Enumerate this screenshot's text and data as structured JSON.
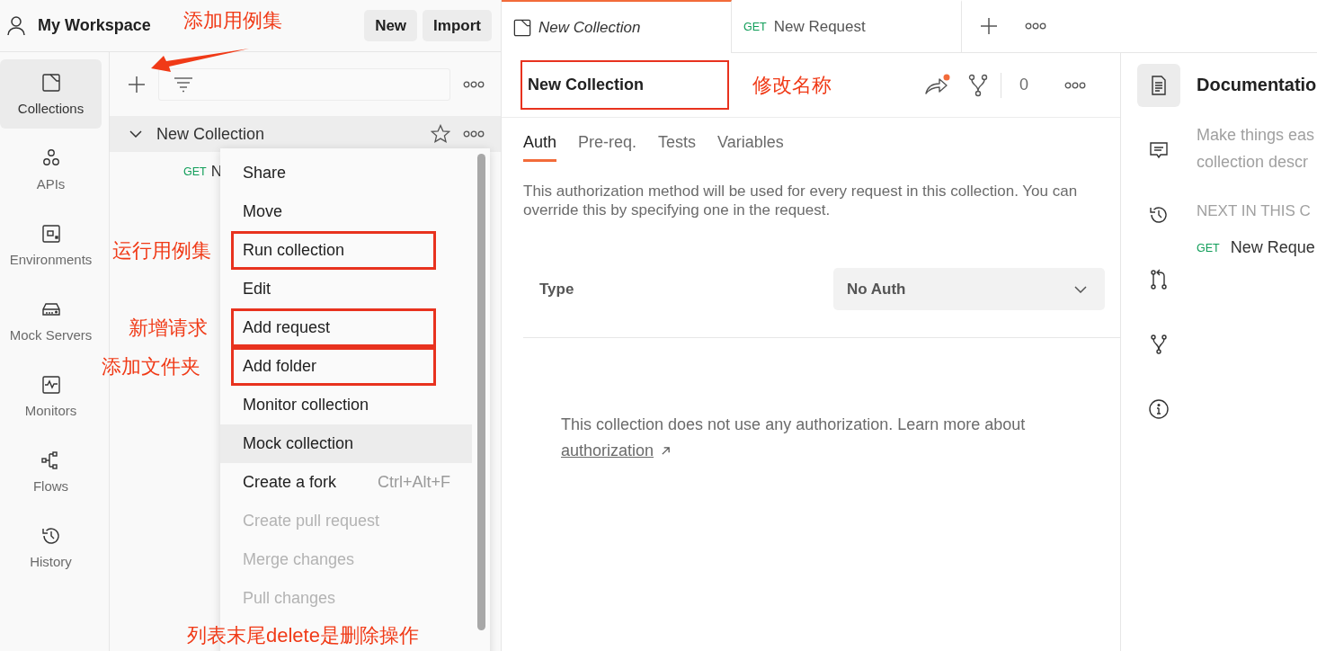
{
  "header": {
    "workspace": "My Workspace",
    "buttons": [
      "New",
      "Import"
    ]
  },
  "nav": [
    {
      "label": "Collections",
      "selected": true
    },
    {
      "label": "APIs",
      "selected": false
    },
    {
      "label": "Environments",
      "selected": false
    },
    {
      "label": "Mock Servers",
      "selected": false
    },
    {
      "label": "Monitors",
      "selected": false
    },
    {
      "label": "Flows",
      "selected": false
    },
    {
      "label": "History",
      "selected": false
    }
  ],
  "sidebar": {
    "collections": [
      {
        "name": "New Collection",
        "expanded": true,
        "starred": false,
        "children": [
          {
            "method": "GET",
            "name": "N"
          }
        ]
      }
    ]
  },
  "context_menu": {
    "items": [
      {
        "label": "Share",
        "disabled": false,
        "highlighted": false,
        "annotated": false
      },
      {
        "label": "Move",
        "disabled": false,
        "highlighted": false,
        "annotated": false
      },
      {
        "label": "Run collection",
        "disabled": false,
        "highlighted": false,
        "annotated": true
      },
      {
        "label": "Edit",
        "disabled": false,
        "highlighted": false,
        "annotated": false
      },
      {
        "label": "Add request",
        "disabled": false,
        "highlighted": false,
        "annotated": true
      },
      {
        "label": "Add folder",
        "disabled": false,
        "highlighted": false,
        "annotated": true
      },
      {
        "label": "Monitor collection",
        "disabled": false,
        "highlighted": false,
        "annotated": false
      },
      {
        "label": "Mock collection",
        "disabled": false,
        "highlighted": true,
        "annotated": false
      },
      {
        "label": "Create a fork",
        "shortcut": "Ctrl+Alt+F",
        "disabled": false,
        "highlighted": false,
        "annotated": false
      },
      {
        "label": "Create pull request",
        "disabled": true,
        "highlighted": false,
        "annotated": false
      },
      {
        "label": "Merge changes",
        "disabled": true,
        "highlighted": false,
        "annotated": false
      },
      {
        "label": "Pull changes",
        "disabled": true,
        "highlighted": false,
        "annotated": false
      }
    ]
  },
  "tabs": [
    {
      "kind": "collection",
      "label": "New Collection",
      "selected": true
    },
    {
      "kind": "request",
      "method": "GET",
      "label": "New Request",
      "selected": false
    }
  ],
  "collection": {
    "name": "New Collection",
    "name_annotated": true,
    "share_notification": true,
    "fork_count": "0",
    "tabs": [
      {
        "label": "Auth",
        "selected": true
      },
      {
        "label": "Pre-req.",
        "selected": false
      },
      {
        "label": "Tests",
        "selected": false
      },
      {
        "label": "Variables",
        "selected": false
      }
    ],
    "auth": {
      "description": "This authorization method will be used for every request in this collection. You can override this by specifying one in the request.",
      "type_label": "Type",
      "type_value": "No Auth",
      "info": "This collection does not use any authorization. Learn more about",
      "link": "authorization"
    }
  },
  "right_panel": {
    "tools": [
      {
        "selected": true
      },
      {
        "selected": false
      },
      {
        "selected": false
      },
      {
        "selected": false
      },
      {
        "selected": false
      },
      {
        "selected": false
      }
    ],
    "title": "Documentatio",
    "description_lines": [
      "Make things eas",
      "collection descr"
    ],
    "next_heading": "NEXT IN THIS C",
    "next_items": [
      {
        "method": "GET",
        "name": "New Reque"
      }
    ]
  },
  "annotations": [
    {
      "text": "添加用例集"
    },
    {
      "text": "修改名称"
    },
    {
      "text": "运行用例集"
    },
    {
      "text": "新增请求"
    },
    {
      "text": "添加文件夹"
    },
    {
      "text": "列表末尾delete是删除操作"
    }
  ]
}
